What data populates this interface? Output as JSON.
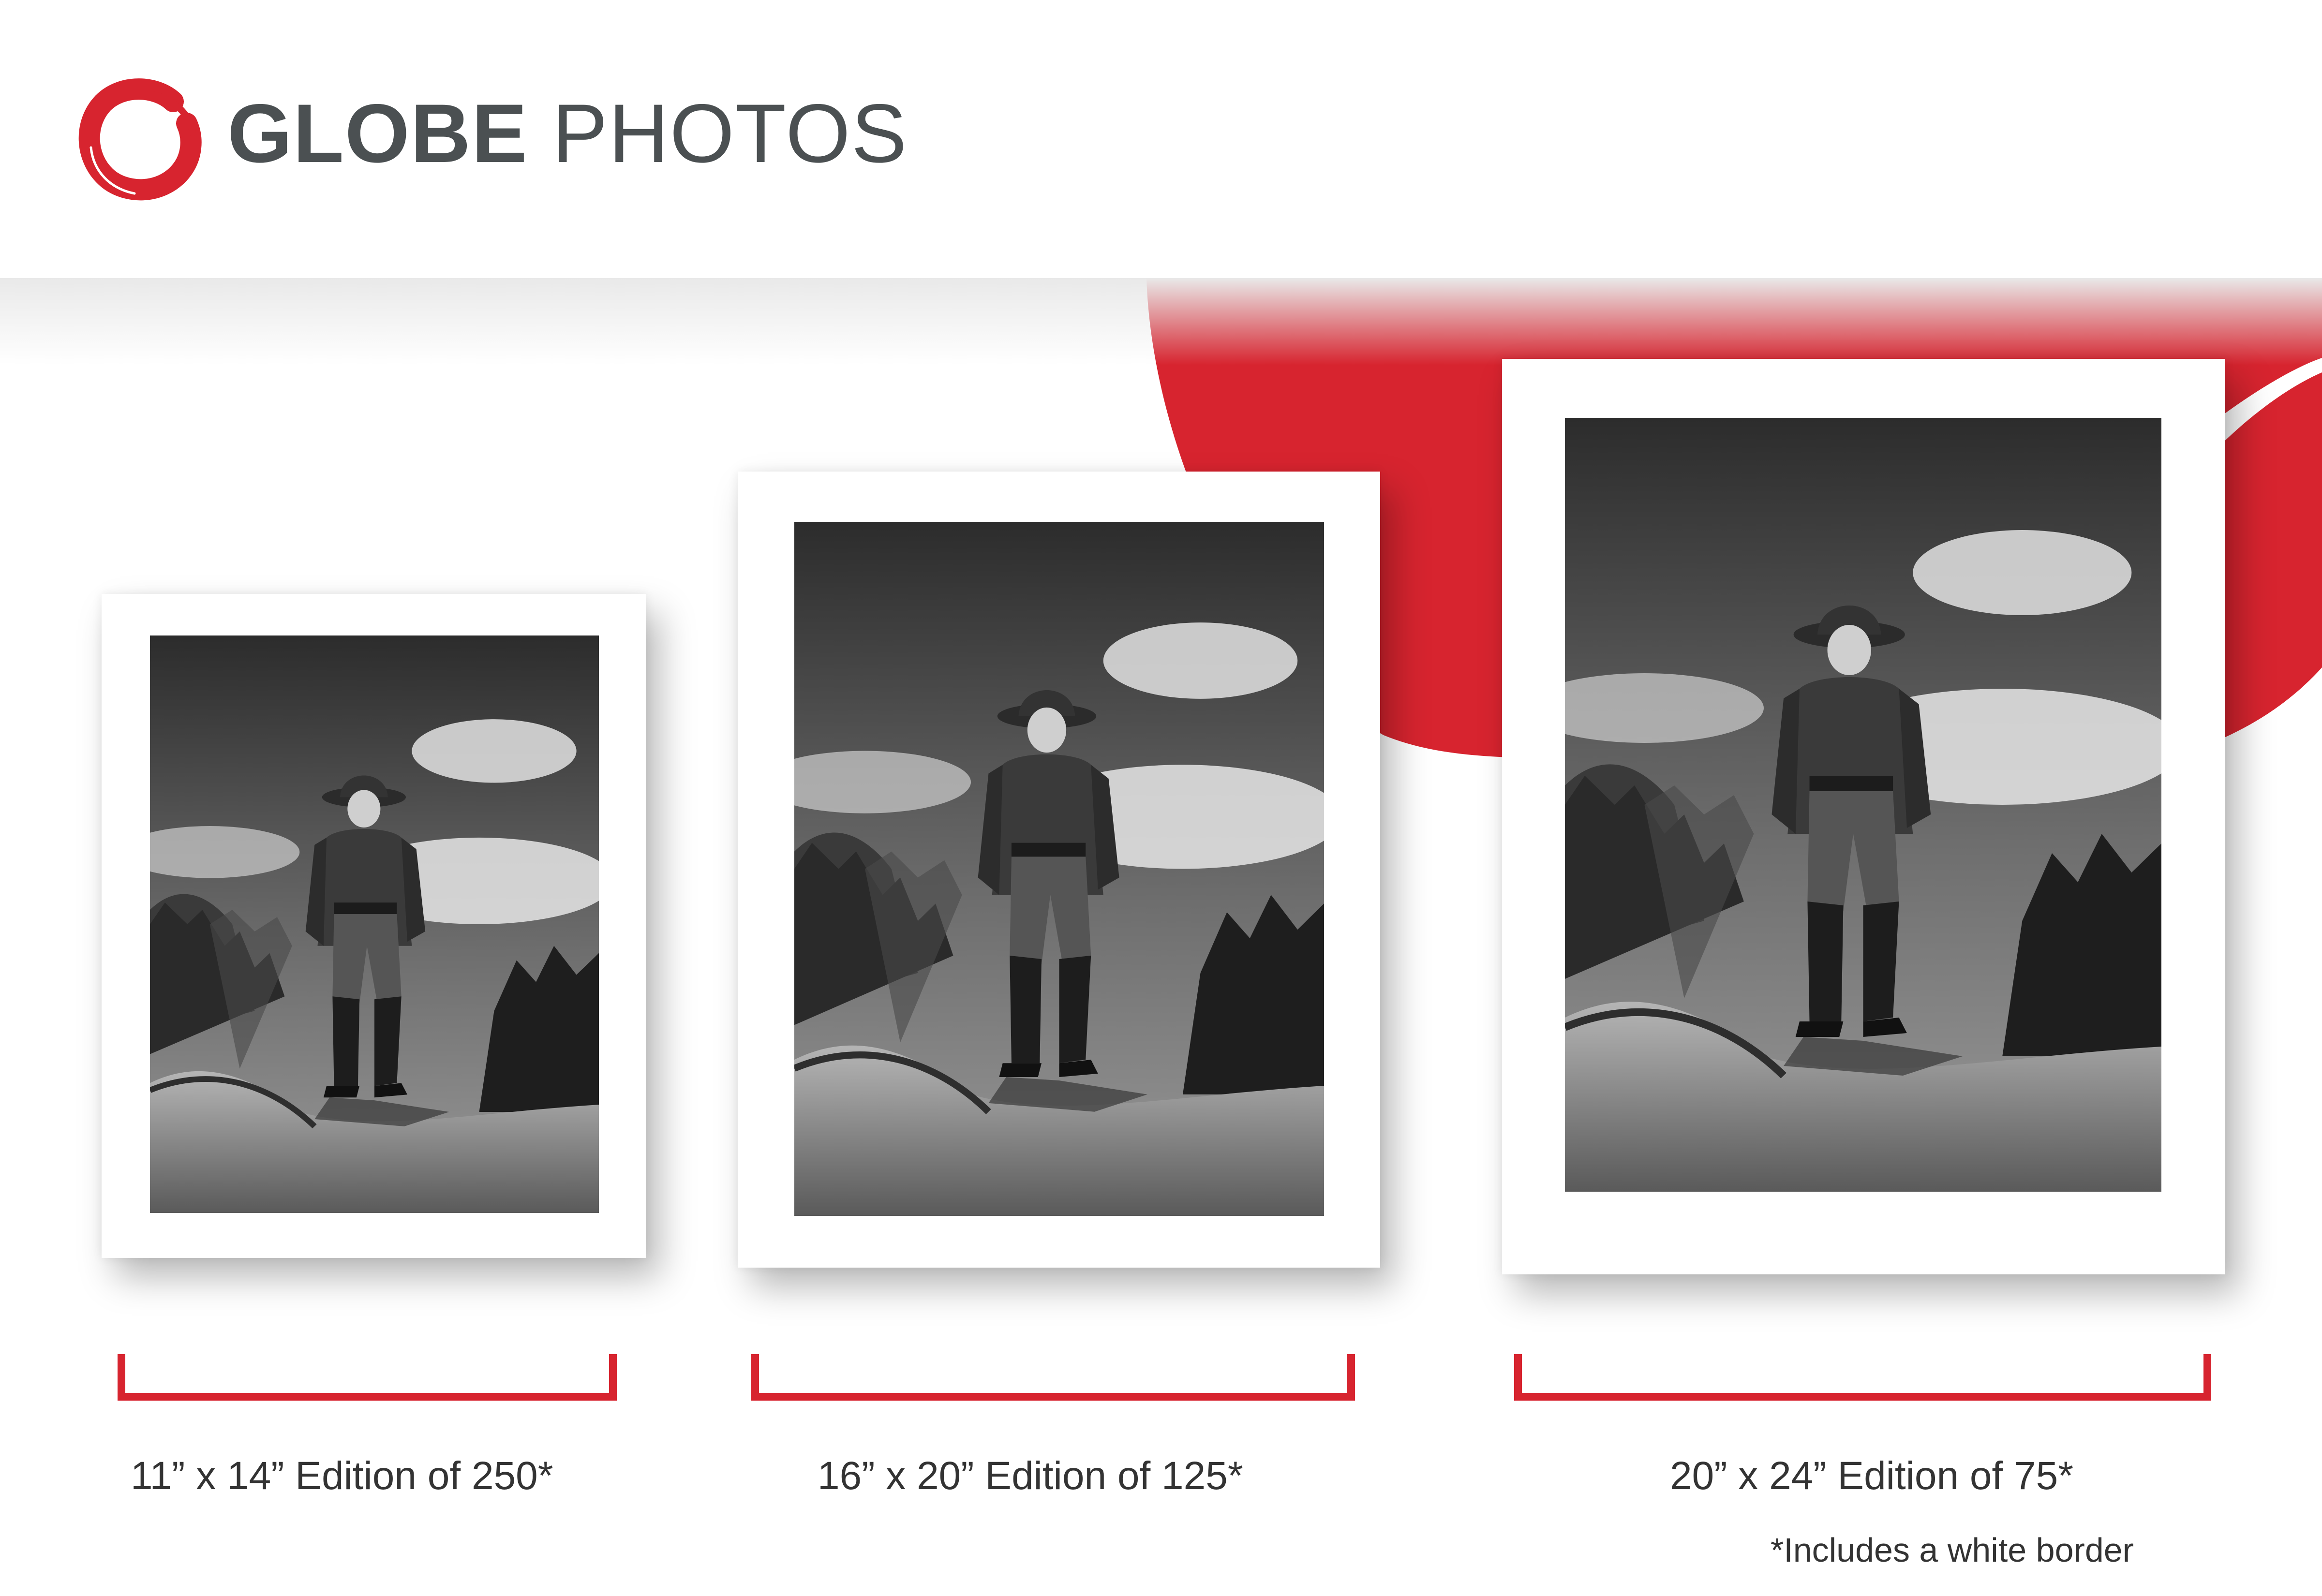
{
  "brand": {
    "name_bold": "GLOBE",
    "name_light": "PHOTOS",
    "accent_color": "#d7242f",
    "text_color": "#4b5052",
    "logo_icon": "brush-circle-logo"
  },
  "editions": [
    {
      "label": "11” x 14” Edition of 250*"
    },
    {
      "label": "16” x 20” Edition of 125*"
    },
    {
      "label": "20” x 24” Edition of 75*"
    }
  ],
  "footnote": "*Includes a white border"
}
